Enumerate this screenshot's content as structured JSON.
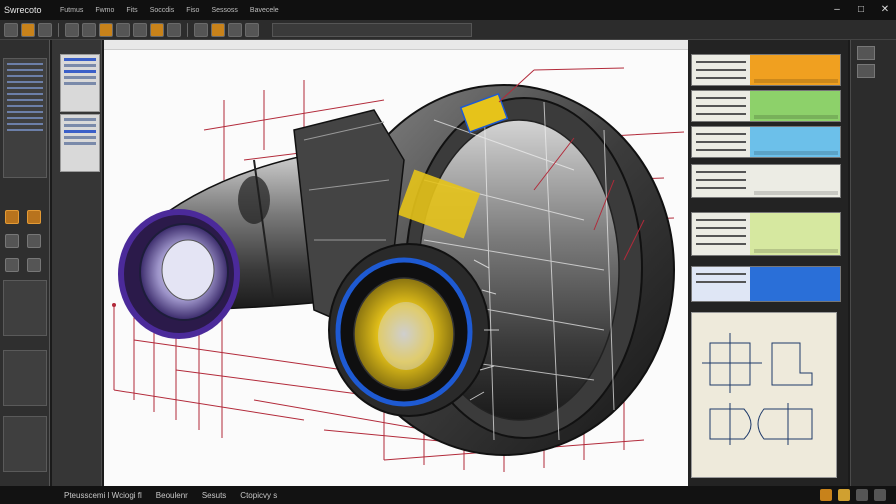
{
  "app": {
    "title": "Swrecoto"
  },
  "menu": [
    "Futmus",
    "Fwmo",
    "Fits",
    "Soccdis",
    "Fiso",
    "Sessoss",
    "Bavecele"
  ],
  "document_tab": {
    "label": ""
  },
  "window_controls": [
    "–",
    "□",
    "✕"
  ],
  "callouts": [
    "",
    "",
    "",
    ""
  ],
  "right_panel": {
    "cards": [
      {
        "label": "",
        "color": "#f0a020"
      },
      {
        "label": "",
        "color": "#8dd16a"
      },
      {
        "label": "",
        "color": "#6cc0ea"
      },
      {
        "label": "",
        "color": "#d6e8a0"
      },
      {
        "label": "",
        "color": "#2a6fd8"
      }
    ]
  },
  "status": [
    "Pteusscemi l Wciogi fl",
    "Beoulenr",
    "Sesuts",
    "Ctopicvy s"
  ],
  "colors": {
    "accent_orange": "#c8821a",
    "lens_purple": "#4b2a9a",
    "lens_blue": "#1e5ad2",
    "bearing_yellow": "#e6c31a",
    "dimension_red": "#b22a3a"
  }
}
